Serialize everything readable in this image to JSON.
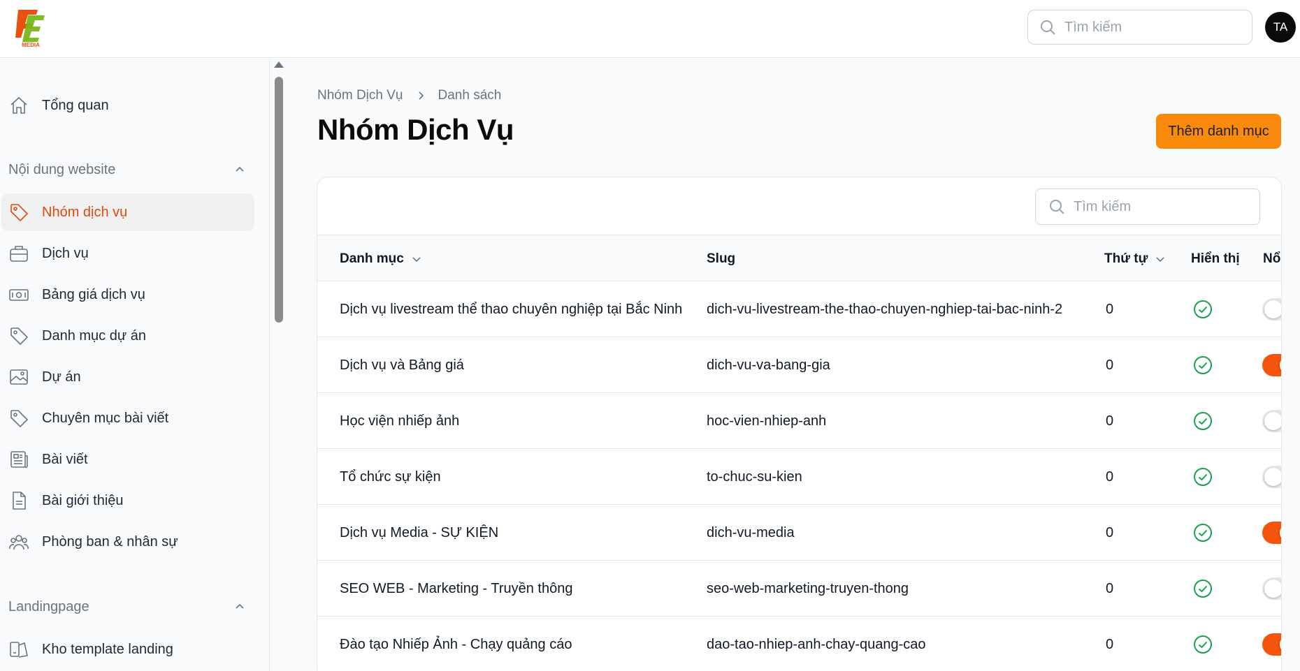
{
  "header": {
    "logo_text": "MEDIA",
    "search_placeholder": "Tìm kiếm",
    "avatar_initials": "TA"
  },
  "sidebar": {
    "top_item": {
      "label": "Tổng quan",
      "icon": "home-icon"
    },
    "sections": [
      {
        "title": "Nội dung website",
        "items": [
          {
            "label": "Nhóm dịch vụ",
            "icon": "tag-icon",
            "active": true
          },
          {
            "label": "Dịch vụ",
            "icon": "briefcase-icon"
          },
          {
            "label": "Bảng giá dịch vụ",
            "icon": "banknote-icon"
          },
          {
            "label": "Danh mục dự án",
            "icon": "tag-icon"
          },
          {
            "label": "Dự án",
            "icon": "image-icon"
          },
          {
            "label": "Chuyên mục bài viết",
            "icon": "tag-icon"
          },
          {
            "label": "Bài viết",
            "icon": "newspaper-icon"
          },
          {
            "label": "Bài giới thiệu",
            "icon": "document-icon"
          },
          {
            "label": "Phòng ban & nhân sự",
            "icon": "users-icon"
          }
        ]
      },
      {
        "title": "Landingpage",
        "items": [
          {
            "label": "Kho template landing",
            "icon": "template-icon"
          }
        ]
      }
    ]
  },
  "breadcrumb": [
    "Nhóm Dịch Vụ",
    "Danh sách"
  ],
  "page_title": "Nhóm Dịch Vụ",
  "add_button_label": "Thêm danh mục",
  "table": {
    "search_placeholder": "Tìm kiếm",
    "columns": [
      "Danh mục",
      "Slug",
      "Thứ tự",
      "Hiển thị",
      "Nổ"
    ],
    "rows": [
      {
        "name": "Dịch vụ livestream thể thao chuyên nghiệp tại Bắc Ninh",
        "slug": "dich-vu-livestream-the-thao-chuyen-nghiep-tai-bac-ninh-2",
        "order": "0",
        "visible": true,
        "featured": false
      },
      {
        "name": "Dịch vụ và Bảng giá",
        "slug": "dich-vu-va-bang-gia",
        "order": "0",
        "visible": true,
        "featured": true
      },
      {
        "name": "Học viện nhiếp ảnh",
        "slug": "hoc-vien-nhiep-anh",
        "order": "0",
        "visible": true,
        "featured": false
      },
      {
        "name": "Tổ chức sự kiện",
        "slug": "to-chuc-su-kien",
        "order": "0",
        "visible": true,
        "featured": false
      },
      {
        "name": "Dịch vụ Media - SỰ KIỆN",
        "slug": "dich-vu-media",
        "order": "0",
        "visible": true,
        "featured": true
      },
      {
        "name": "SEO WEB - Marketing - Truyền thông",
        "slug": "seo-web-marketing-truyen-thong",
        "order": "0",
        "visible": true,
        "featured": false
      },
      {
        "name": "Đào tạo Nhiếp Ảnh - Chạy quảng cáo",
        "slug": "dao-tao-nhiep-anh-chay-quang-cao",
        "order": "0",
        "visible": true,
        "featured": true
      }
    ]
  },
  "colors": {
    "accent_orange": "#f98a0b",
    "active_text": "#dc4a0c",
    "toggle_on": "#f4540c",
    "check_green": "#16a34a"
  }
}
